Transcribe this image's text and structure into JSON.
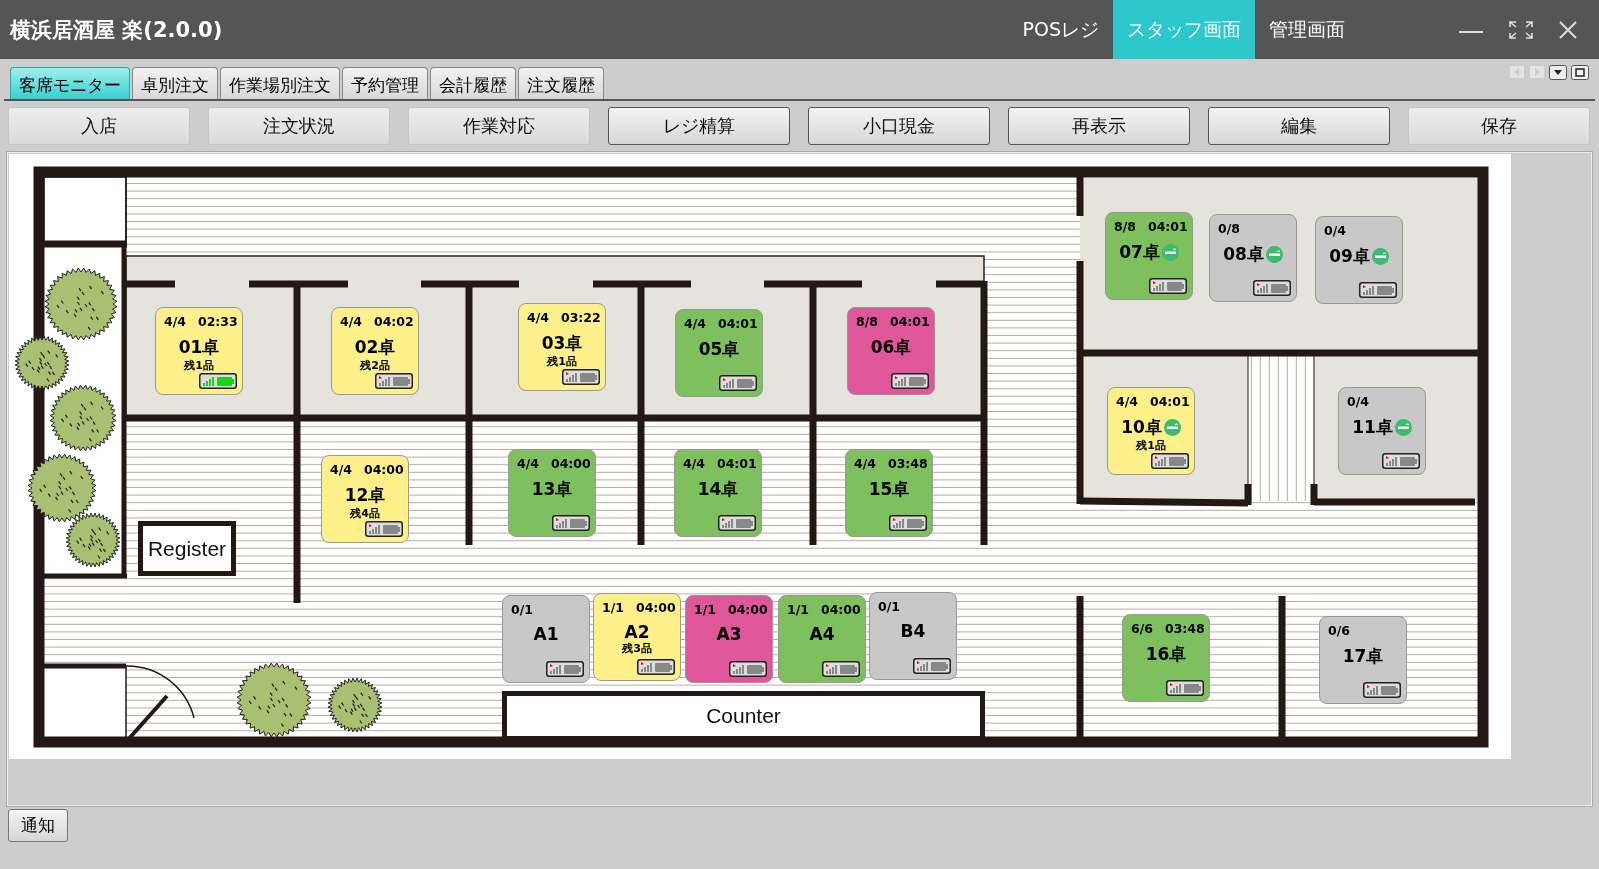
{
  "window": {
    "title": "横浜居酒屋 楽(2.0.0)"
  },
  "nav": [
    {
      "label": "POSレジ",
      "selected": false
    },
    {
      "label": "スタッフ画面",
      "selected": true
    },
    {
      "label": "管理画面",
      "selected": false
    }
  ],
  "tabs": [
    {
      "label": "客席モニター",
      "selected": true
    },
    {
      "label": "卓別注文",
      "selected": false
    },
    {
      "label": "作業場別注文",
      "selected": false
    },
    {
      "label": "予約管理",
      "selected": false
    },
    {
      "label": "会計履歴",
      "selected": false
    },
    {
      "label": "注文履歴",
      "selected": false
    }
  ],
  "toolbar": [
    {
      "label": "入店",
      "disabled": true
    },
    {
      "label": "注文状況",
      "disabled": true
    },
    {
      "label": "作業対応",
      "disabled": true
    },
    {
      "label": "レジ精算",
      "disabled": false
    },
    {
      "label": "小口現金",
      "disabled": false
    },
    {
      "label": "再表示",
      "disabled": false
    },
    {
      "label": "編集",
      "disabled": false
    },
    {
      "label": "保存",
      "disabled": true
    }
  ],
  "floor": {
    "labels": [
      "Register",
      "Counter"
    ],
    "tables": [
      {
        "name": "01卓",
        "guests": "4/4",
        "time": "02:33",
        "remaining": "残1品",
        "color": "#fdf08a",
        "smoking": false,
        "device_online": true
      },
      {
        "name": "02卓",
        "guests": "4/4",
        "time": "04:02",
        "remaining": "残2品",
        "color": "#fdf08a",
        "smoking": false,
        "device_online": false
      },
      {
        "name": "03卓",
        "guests": "4/4",
        "time": "03:22",
        "remaining": "残1品",
        "color": "#fdf08a",
        "smoking": false,
        "device_online": false
      },
      {
        "name": "05卓",
        "guests": "4/4",
        "time": "04:01",
        "color": "#7dc05d",
        "smoking": false,
        "device_online": false
      },
      {
        "name": "06卓",
        "guests": "8/8",
        "time": "04:01",
        "color": "#e0569b",
        "smoking": false,
        "device_online": false
      },
      {
        "name": "07卓",
        "guests": "8/8",
        "time": "04:01",
        "color": "#7dc05d",
        "smoking": true,
        "device_online": false
      },
      {
        "name": "08卓",
        "guests": "0/8",
        "color": "#c8c8c8",
        "smoking": true,
        "device_online": false
      },
      {
        "name": "09卓",
        "guests": "0/4",
        "color": "#c8c8c8",
        "smoking": true,
        "device_online": false
      },
      {
        "name": "10卓",
        "guests": "4/4",
        "time": "04:01",
        "remaining": "残1品",
        "color": "#fdf08a",
        "smoking": true,
        "device_online": false
      },
      {
        "name": "11卓",
        "guests": "0/4",
        "color": "#c8c8c8",
        "smoking": true,
        "device_online": false
      },
      {
        "name": "12卓",
        "guests": "4/4",
        "time": "04:00",
        "remaining": "残4品",
        "color": "#fdf08a",
        "smoking": false,
        "device_online": false
      },
      {
        "name": "13卓",
        "guests": "4/4",
        "time": "04:00",
        "color": "#7dc05d",
        "smoking": false,
        "device_online": false
      },
      {
        "name": "14卓",
        "guests": "4/4",
        "time": "04:01",
        "color": "#7dc05d",
        "smoking": false,
        "device_online": false
      },
      {
        "name": "15卓",
        "guests": "4/4",
        "time": "03:48",
        "color": "#7dc05d",
        "smoking": false,
        "device_online": false
      },
      {
        "name": "A1",
        "guests": "0/1",
        "color": "#c8c8c8",
        "smoking": false,
        "device_online": false
      },
      {
        "name": "A2",
        "guests": "1/1",
        "time": "04:00",
        "remaining": "残3品",
        "color": "#fdf08a",
        "smoking": false,
        "device_online": false
      },
      {
        "name": "A3",
        "guests": "1/1",
        "time": "04:00",
        "color": "#e0569b",
        "smoking": false,
        "device_online": false
      },
      {
        "name": "A4",
        "guests": "1/1",
        "time": "04:00",
        "color": "#7dc05d",
        "smoking": false,
        "device_online": false
      },
      {
        "name": "B4",
        "guests": "0/1",
        "color": "#c8c8c8",
        "smoking": false,
        "device_online": false
      },
      {
        "name": "16卓",
        "guests": "6/6",
        "time": "03:48",
        "color": "#7dc05d",
        "smoking": false,
        "device_online": false
      },
      {
        "name": "17卓",
        "guests": "0/6",
        "color": "#c8c8c8",
        "smoking": false,
        "device_online": false
      }
    ]
  },
  "footer": {
    "button": "通知"
  }
}
